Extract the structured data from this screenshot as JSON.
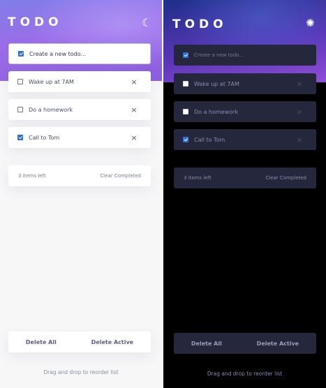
{
  "light": {
    "title": "TODO",
    "theme_icon": "☾",
    "new_todo_placeholder": "Create a new todo...",
    "new_todo_checked": true,
    "items": [
      {
        "label": "Wake up at 7AM",
        "checked": false
      },
      {
        "label": "Do a homework",
        "checked": false
      },
      {
        "label": "Call to Tom",
        "checked": true
      }
    ],
    "footer": {
      "left": "3 items left",
      "right": "Clear Completed"
    },
    "bottom": {
      "delete_all": "Delete All",
      "delete_active": "Delete Active"
    },
    "hint": "Drag and drop to reorder list"
  },
  "dark": {
    "title": "TODO",
    "theme_icon": "✺",
    "new_todo_placeholder": "Create a new todo...",
    "new_todo_checked": true,
    "items": [
      {
        "label": "Wake up at 7AM",
        "checked": false
      },
      {
        "label": "Do a homework",
        "checked": false
      },
      {
        "label": "Call to Tom",
        "checked": true
      }
    ],
    "footer": {
      "left": "3 items left",
      "right": "Clear Completed"
    },
    "bottom": {
      "delete_all": "Delete All",
      "delete_active": "Delete Active"
    },
    "hint": "Drag and drop to reorder list"
  },
  "icons": {
    "delete": "×",
    "light_theme_toggle": "moon-icon",
    "dark_theme_toggle": "sun-icon"
  },
  "colors": {
    "checkbox_checked": "#2f6fe0",
    "light_background": "#f7f7f8",
    "dark_background": "#000000",
    "dark_card": "#25273c",
    "light_header_gradient": [
      "#7f7ee8",
      "#9c6ce8"
    ],
    "dark_header_gradient": [
      "#1d2f88",
      "#8f4fd8"
    ]
  }
}
